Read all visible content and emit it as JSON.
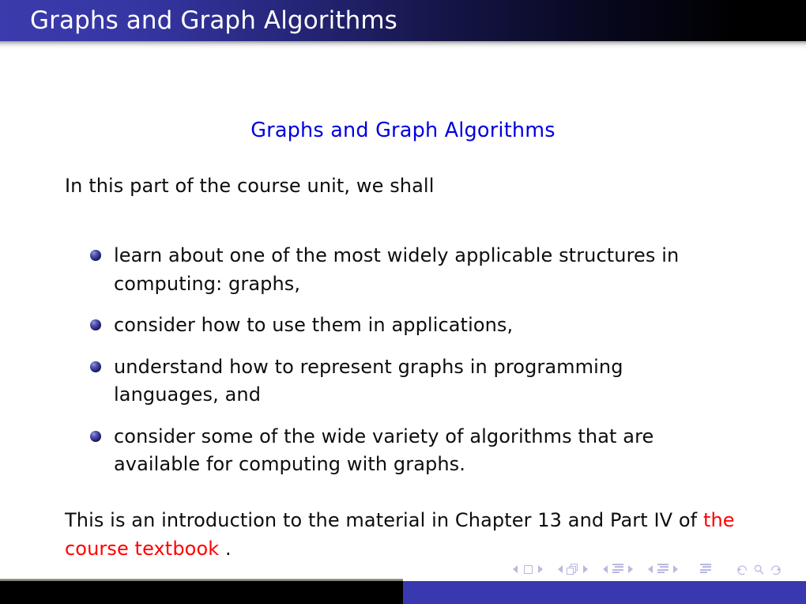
{
  "header": {
    "title": "Graphs and Graph Algorithms",
    "gradient_start": "#3b3bad",
    "gradient_end": "#000000",
    "title_color": "#ffffff"
  },
  "slide": {
    "frame_title": "Graphs and Graph Algorithms",
    "frame_title_color": "#0000e0",
    "intro": "In this part of the course unit, we shall",
    "bullets": [
      "learn about one of the most widely applicable structures in computing: graphs,",
      "consider how to use them in applications,",
      "understand how to represent graphs in programming languages, and",
      "consider some of the wide variety of algorithms that are available for computing with graphs."
    ],
    "bullet_color": "#2f2f8e",
    "closing": {
      "before_link": "This is an introduction to the material in Chapter 13 and Part IV of ",
      "link_text": "the course textbook",
      "after_link": " .",
      "link_color": "#ff0000"
    }
  },
  "navigation": {
    "groups": [
      {
        "icon": "slide-square-icon",
        "prev": "prev-slide-arrow",
        "next": "next-slide-arrow"
      },
      {
        "icon": "frames-stack-icon",
        "prev": "prev-frame-arrow",
        "next": "next-frame-arrow"
      },
      {
        "icon": "subsection-lines-icon",
        "prev": "prev-subsection-arrow",
        "next": "next-subsection-arrow"
      },
      {
        "icon": "section-lines-icon",
        "prev": "prev-section-arrow",
        "next": "next-section-arrow"
      }
    ],
    "doc_icon": "document-lines-icon",
    "back_icon": "back-arrow-icon",
    "search_icon": "search-icon",
    "forward_icon": "forward-arrow-icon",
    "color": "#b9b9e0"
  },
  "footer": {
    "left_color": "#000000",
    "right_color": "#3a38ae"
  }
}
